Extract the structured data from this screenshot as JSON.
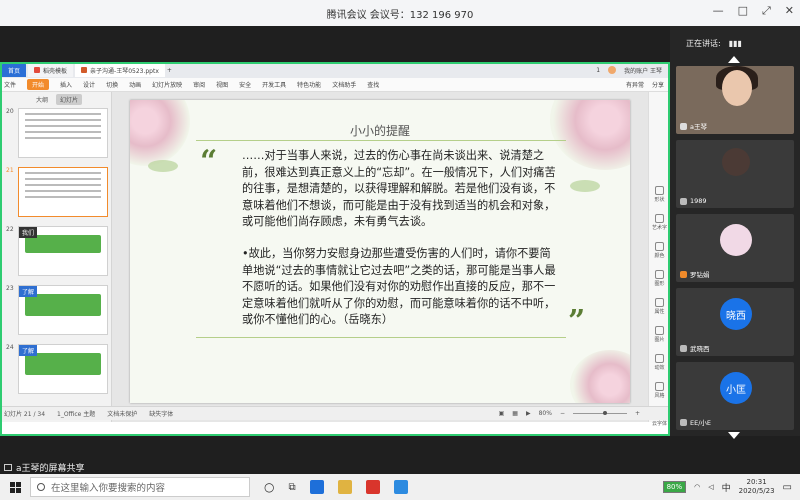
{
  "meeting": {
    "title": "腾讯会议 会议号：132 196 970",
    "controls": [
      "—",
      "□",
      "⤢",
      "✕"
    ]
  },
  "wps": {
    "tabs": [
      {
        "label": "首页"
      },
      {
        "label": "稻壳模板"
      },
      {
        "label": "亲子沟通-王琴0523.pptx"
      }
    ],
    "new_tab": "+",
    "header_right": [
      "1",
      "我的账户 王琴"
    ],
    "ribbon": [
      "文件",
      "开始",
      "插入",
      "设计",
      "切换",
      "动画",
      "幻灯片放映",
      "审阅",
      "视图",
      "安全",
      "开发工具",
      "特色功能",
      "文档助手",
      "查找"
    ],
    "ribbon_tools": [
      "有异常",
      "分享"
    ],
    "pane_tabs": [
      "大纲",
      "幻灯片"
    ],
    "thumbnails": [
      {
        "num": "20",
        "tag": ""
      },
      {
        "num": "21",
        "tag": ""
      },
      {
        "num": "22",
        "tag": "我们"
      },
      {
        "num": "23",
        "tag": "了解"
      },
      {
        "num": "24",
        "tag": "了解"
      }
    ],
    "right_tools": [
      "形状",
      "艺术字",
      "颜色",
      "图形",
      "属性",
      "图片",
      "动效",
      "风格",
      "云字体",
      "设置"
    ],
    "status": {
      "slide_info": "幻灯片 21 / 34",
      "theme": "1_Office 主题",
      "protect": "文档未保护",
      "missing_font": "缺失字体",
      "zoom": "80%"
    }
  },
  "slide": {
    "title": "小小的提醒",
    "para1": "……对于当事人来说，过去的伤心事在尚未谈出来、说清楚之前，很难达到真正意义上的“忘却”。在一般情况下，人们对痛苦的往事，是想清楚的，以获得理解和解脱。若是他们没有谈，不意味着他们不想谈，而可能是由于没有找到适当的机会和对象，或可能他们尚存顾虑，未有勇气去谈。",
    "para2": "•故此，当你努力安慰身边那些遭受伤害的人们时，请你不要简单地说“过去的事情就让它过去吧”之类的话，那可能是当事人最不愿听的话。如果他们没有对你的劝慰作出直接的反应，那不一定意味着他们就听从了你的劝慰，而可能意味着你的话不中听，或你不懂他们的心。（岳晓东）",
    "open_quote": "“",
    "close_quote": "”"
  },
  "panel": {
    "heading": "正在讲话:",
    "participants": [
      {
        "name": "a王琴",
        "avatar_text": ""
      },
      {
        "name": "1989",
        "avatar_text": ""
      },
      {
        "name": "罗钻娟",
        "avatar_text": ""
      },
      {
        "name": "武晓西",
        "avatar_text": "晓西"
      },
      {
        "name": "EE/小E",
        "avatar_text": "小匡"
      }
    ]
  },
  "share_label": "a王琴的屏幕共享",
  "taskbar": {
    "search_placeholder": "在这里输入你要搜索的内容",
    "battery": "80%",
    "ime": "中",
    "time": "20:31",
    "date": "2020/5/23"
  }
}
